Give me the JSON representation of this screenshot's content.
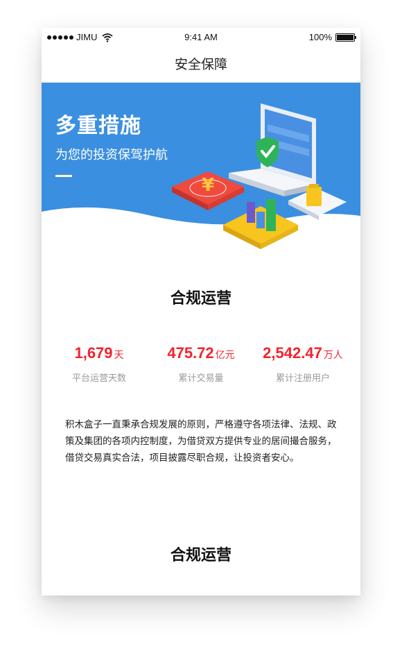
{
  "status_bar": {
    "carrier": "JIMU",
    "time": "9:41 AM",
    "battery": "100%"
  },
  "nav": {
    "title": "安全保障"
  },
  "banner": {
    "title": "多重措施",
    "subtitle": "为您的投资保驾护航",
    "colors": {
      "background": "#3b8fe0",
      "accent": "#2fb35a"
    }
  },
  "section1": {
    "title": "合规运营"
  },
  "stats": [
    {
      "value": "1,679",
      "unit": "天",
      "label": "平台运营天数"
    },
    {
      "value": "475.72",
      "unit": "亿元",
      "label": "累计交易量"
    },
    {
      "value": "2,542.47",
      "unit": "万人",
      "label": "累计注册用户"
    }
  ],
  "description": "积木盒子一直秉承合规发展的原则，严格遵守各项法律、法规、政策及集团的各项内控制度，为借贷双方提供专业的居间撮合服务，借贷交易真实合法，项目披露尽职合规，让投资者安心。",
  "section2": {
    "title": "合规运营"
  },
  "colors": {
    "highlight": "#ffec00",
    "stat_red": "#f5222d",
    "label_gray": "#9a9a9a"
  }
}
